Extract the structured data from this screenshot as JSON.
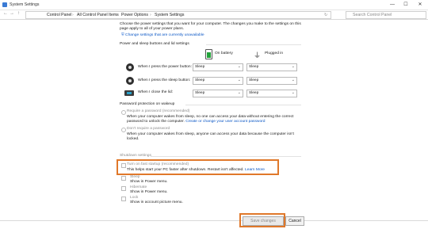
{
  "window": {
    "title": "System Settings",
    "minimize": "—",
    "maximize": "☐",
    "close": "✕"
  },
  "address": {
    "back": "←",
    "forward": "→",
    "up": "↑",
    "refresh": "↻",
    "crumbs": [
      "Control Panel",
      "All Control Panel Items",
      "Power Options",
      "System Settings"
    ],
    "sep": "›",
    "search_placeholder": "Search Control Panel"
  },
  "intro": {
    "line1": "Choose the power settings that you want for your computer. The changes you make to the settings on this",
    "line2": "page apply to all of your power plans.",
    "change_link": "Change settings that are currently unavailable"
  },
  "power_buttons": {
    "heading": "Power and sleep buttons and lid settings",
    "col_battery": "On battery",
    "col_plugged": "Plugged in",
    "rows": [
      {
        "label": "When I press the power button:",
        "battery": "Sleep",
        "plugged": "Sleep"
      },
      {
        "label": "When I press the sleep button:",
        "battery": "Sleep",
        "plugged": "Sleep"
      },
      {
        "label": "When I close the lid:",
        "battery": "Sleep",
        "plugged": "Sleep"
      }
    ]
  },
  "password": {
    "heading": "Password protection on wakeup",
    "opt1_label": "Require a password (recommended)",
    "opt1_desc1": "When your computer wakes from sleep, no one can access your data without entering the correct",
    "opt1_desc2": "password to unlock the computer.",
    "opt1_link": "Create or change your user account password",
    "opt2_label": "Don't require a password",
    "opt2_desc1": "When your computer wakes from sleep, anyone can access your data because the computer isn't",
    "opt2_desc2": "locked."
  },
  "shutdown": {
    "heading": "Shutdown settings",
    "items": [
      {
        "label": "Turn on fast startup (recommended)",
        "desc": "This helps start your PC faster after shutdown. Restart isn't affected.",
        "link": "Learn More"
      },
      {
        "label": "Sleep",
        "desc": "Show in Power menu."
      },
      {
        "label": "Hibernate",
        "desc": "Show in Power menu."
      },
      {
        "label": "Lock",
        "desc": "Show in account picture menu."
      }
    ]
  },
  "footer": {
    "save": "Save changes",
    "cancel": "Cancel"
  },
  "colors": {
    "highlight": "#e0782a",
    "link": "#0b57c5"
  }
}
